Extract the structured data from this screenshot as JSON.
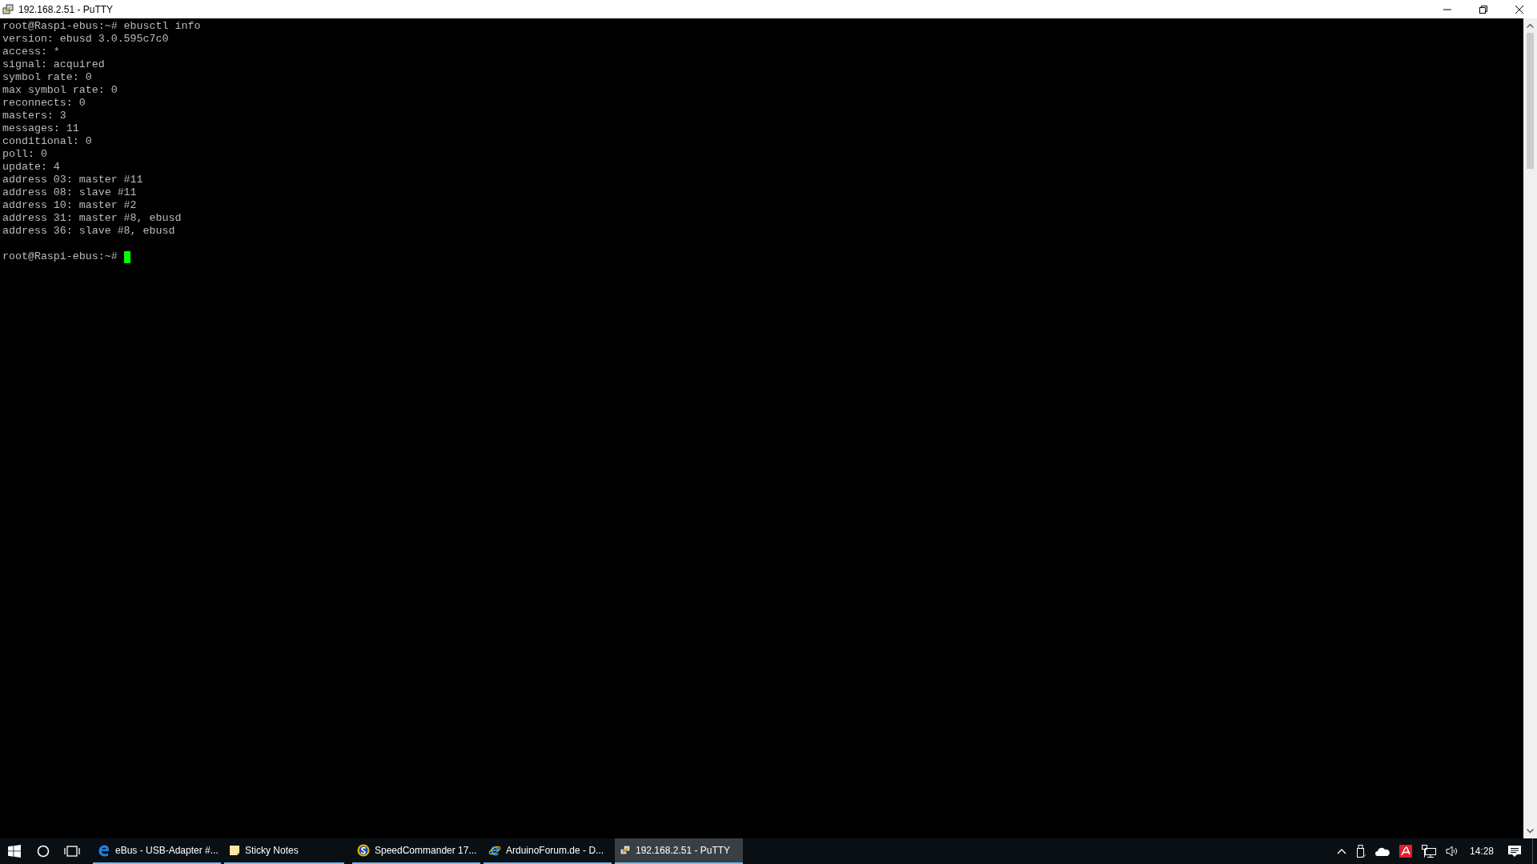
{
  "window": {
    "title": "192.168.2.51 - PuTTY"
  },
  "terminal": {
    "lines": [
      "root@Raspi-ebus:~# ebusctl info",
      "version: ebusd 3.0.595c7c0",
      "access: *",
      "signal: acquired",
      "symbol rate: 0",
      "max symbol rate: 0",
      "reconnects: 0",
      "masters: 3",
      "messages: 11",
      "conditional: 0",
      "poll: 0",
      "update: 4",
      "address 03: master #11",
      "address 08: slave #11",
      "address 10: master #2",
      "address 31: master #8, ebusd",
      "address 36: slave #8, ebusd"
    ],
    "prompt": "root@Raspi-ebus:~#"
  },
  "taskbar": {
    "apps": [
      {
        "label": "eBus - USB-Adapter #...",
        "kind": "edge",
        "selected": false
      },
      {
        "label": "Sticky Notes",
        "kind": "notes",
        "selected": false
      },
      {
        "label": "SpeedCommander 17...",
        "kind": "speed",
        "selected": false
      },
      {
        "label": "ArduinoForum.de - D...",
        "kind": "ie",
        "selected": false
      },
      {
        "label": "192.168.2.51 - PuTTY",
        "kind": "putty",
        "selected": true
      }
    ],
    "clock": "14:28"
  }
}
